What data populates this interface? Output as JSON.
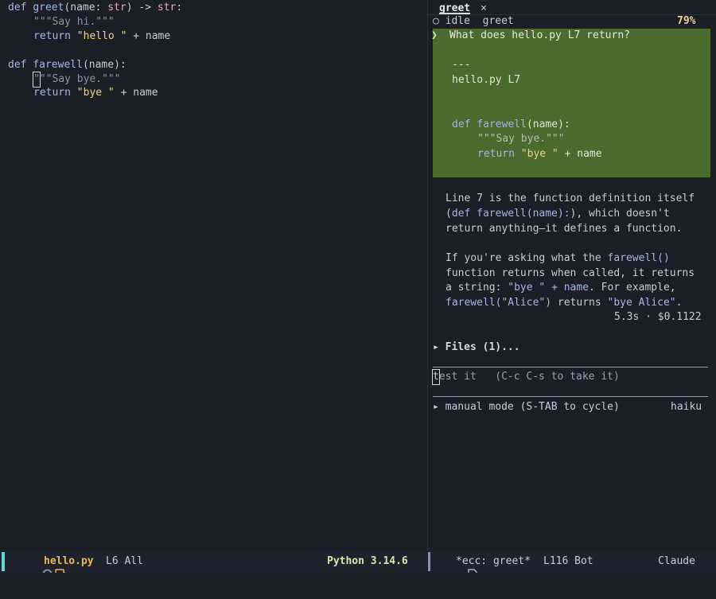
{
  "editor": {
    "lines": [
      {
        "kind": "def1"
      },
      {
        "kind": "doc1"
      },
      {
        "kind": "ret1"
      },
      {
        "kind": "blank"
      },
      {
        "kind": "def2"
      },
      {
        "kind": "doc2"
      },
      {
        "kind": "ret2"
      }
    ],
    "greet_def": {
      "kw": "def ",
      "name": "greet",
      "open": "(",
      "param": "name",
      "colon": ": ",
      "type": "str",
      "close": ")",
      "arrow": " -> ",
      "ret": "str",
      "end": ":"
    },
    "greet_doc": "\"\"\"Say hi.\"\"\"",
    "greet_ret": {
      "kw": "return ",
      "str": "\"hello \"",
      "rest": " + name"
    },
    "farewell_def": {
      "kw": "def ",
      "name": "farewell",
      "rest": "(name):"
    },
    "farewell_doc_cursor": "\"",
    "farewell_doc": "\"\"Say bye.\"\"\"",
    "farewell_ret": {
      "kw": "return ",
      "str": "\"bye \"",
      "rest": " + name"
    }
  },
  "chat": {
    "tab_label": "greet",
    "tab_close": "×",
    "status_icon": "○",
    "status_text": "idle  greet",
    "context_percent": "79%",
    "prompt_arrow": "❯",
    "prompt_text": "What does hello.py L7 return?",
    "quote_sep": "---",
    "quote_file": "hello.py L7",
    "quote_def_kw": "def ",
    "quote_def_name": "farewell",
    "quote_def_rest": "(name):",
    "quote_doc": "\"\"\"Say bye.\"\"\"",
    "quote_ret_kw": "return ",
    "quote_ret_str": "\"bye \"",
    "quote_ret_rest": " + name",
    "resp1_a": "Line 7 is the function definition itself",
    "resp1_b_pre": "(",
    "resp1_b_code": "def farewell(name):",
    "resp1_b_post": "), which doesn't",
    "resp1_c": "return anything—it defines a function.",
    "resp2_a_pre": "If you're asking what the ",
    "resp2_a_code": "farewell()",
    "resp2_b": "function returns when called, it returns",
    "resp2_c_pre": "a string: ",
    "resp2_c_code": "\"bye \" + name",
    "resp2_c_post": ". For example,",
    "resp2_d_code1": "farewell(\"Alice\")",
    "resp2_d_mid": " returns ",
    "resp2_d_code2": "\"bye Alice\"",
    "resp2_d_post": ".",
    "meta": "5.3s · $0.1122",
    "files_label": "▸ Files (1)...",
    "input_cursor_char": "t",
    "input_text": "est it   (C-c C-s to take it)",
    "mode_text": "▸ manual mode (S-TAB to cycle)",
    "model": "haiku"
  },
  "modeline_left": {
    "filename": "hello.py",
    "position": "L6 All",
    "language": "Python 3.14.6",
    "accent": "#5fd7d7"
  },
  "modeline_right": {
    "buffer": "*ecc: greet*",
    "position": "L116 Bot",
    "agent": "Claude",
    "accent": "#8e8fb0"
  }
}
